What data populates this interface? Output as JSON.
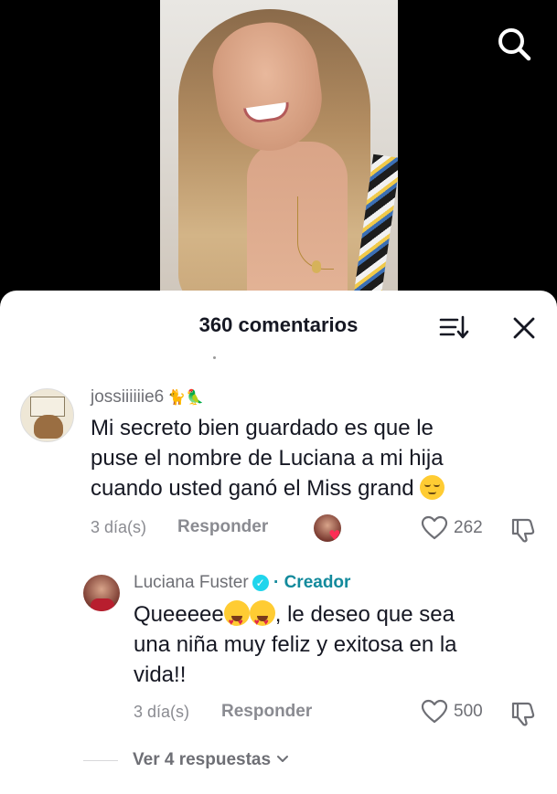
{
  "header": {
    "comment_count_title": "360 comentarios"
  },
  "icons": {
    "search": "search-icon",
    "sort": "sort-icon",
    "close": "close-icon",
    "like": "heart-outline-icon",
    "dislike": "thumbs-down-icon",
    "verified": "verified-badge-icon",
    "chevron": "chevron-down-icon"
  },
  "comments": [
    {
      "username": "jossiiiiiie6",
      "username_emoji": "🐈🦜",
      "text_lines": [
        "Mi secreto bien guardado es que le",
        "puse el nombre de Luciana a mi hija",
        "cuando usted ganó el Miss grand"
      ],
      "end_emoji": "relieved-face-emoji",
      "time": "3 día(s)",
      "reply_label": "Responder",
      "likes": "262",
      "creator_liked": true
    }
  ],
  "reply": {
    "username": "Luciana Fuster",
    "creator_label": "· Creador",
    "text_start": "Queeeee",
    "text_after_emoji": ", le deseo que sea",
    "text_lines": [
      "una niña muy feliz y exitosa en la",
      "vida!!"
    ],
    "emoji": "heart-eyes-emoji",
    "time": "3 día(s)",
    "reply_label": "Responder",
    "likes": "500"
  },
  "view_more": {
    "label": "Ver 4 respuestas"
  },
  "colors": {
    "creator_accent": "#138a9c",
    "verified_badge": "#20d5ec",
    "liked_heart": "#fe2c55",
    "text_primary": "#161823",
    "text_secondary": "#8a8b91"
  }
}
